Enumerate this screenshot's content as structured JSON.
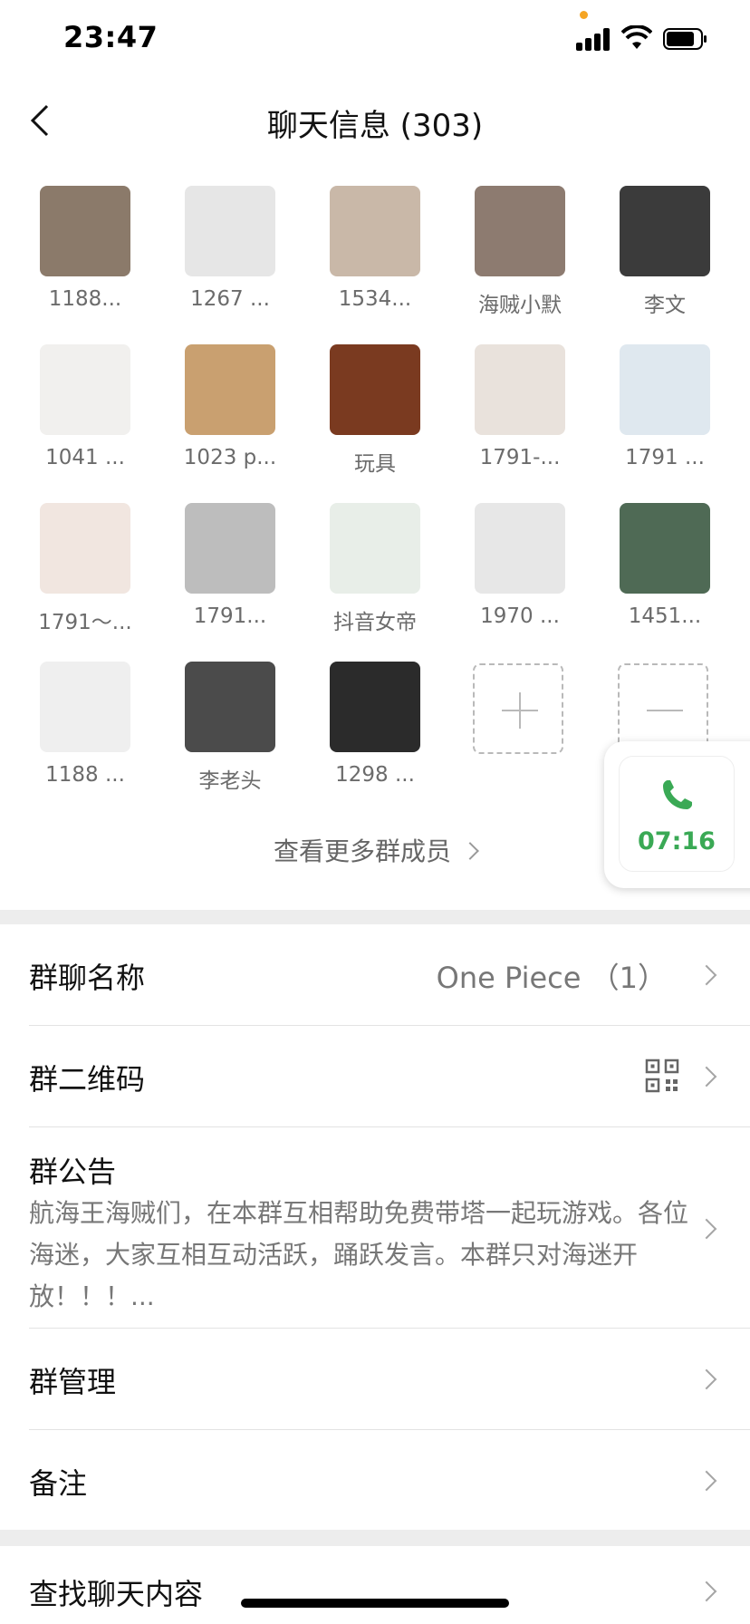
{
  "status": {
    "time": "23:47"
  },
  "header": {
    "title": "聊天信息 (303)"
  },
  "members": [
    {
      "name": "1188...",
      "color": "#8b7a6a"
    },
    {
      "name": "1267 ...",
      "color": "#e6e6e6"
    },
    {
      "name": "1534...",
      "color": "#c9b8a8"
    },
    {
      "name": "海贼小默",
      "color": "#8d7b70"
    },
    {
      "name": "李文",
      "color": "#3b3b3b"
    },
    {
      "name": "1041 ...",
      "color": "#f1f0ee"
    },
    {
      "name": "1023 p...",
      "color": "#c9a070"
    },
    {
      "name": "玩具",
      "color": "#7a3a20"
    },
    {
      "name": "1791-...",
      "color": "#e9e2dc"
    },
    {
      "name": "1791 ...",
      "color": "#dfe8ef"
    },
    {
      "name": "1791～...",
      "color": "#f1e6e0"
    },
    {
      "name": "1791...",
      "color": "#bdbdbd"
    },
    {
      "name": "抖音女帝",
      "color": "#e8eee8"
    },
    {
      "name": "1970 ...",
      "color": "#e7e7e7"
    },
    {
      "name": "1451...",
      "color": "#4f6a55"
    },
    {
      "name": "1188 ...",
      "color": "#efefef"
    },
    {
      "name": "李老头",
      "color": "#4b4b4b"
    },
    {
      "name": "1298 ...",
      "color": "#2b2b2b"
    }
  ],
  "view_more": "查看更多群成员",
  "call": {
    "duration": "07:16",
    "accent": "#3aa955"
  },
  "settings": {
    "group_name_label": "群聊名称",
    "group_name_value": "One Piece （1）",
    "qr_label": "群二维码",
    "announcement_label": "群公告",
    "announcement_text": "航海王海贼们，在本群互相帮助免费带塔一起玩游戏。各位海迷，大家互相互动活跃，踊跃发言。本群只对海迷开放！！！...",
    "manage_label": "群管理",
    "remark_label": "备注",
    "search_label": "查找聊天内容"
  }
}
